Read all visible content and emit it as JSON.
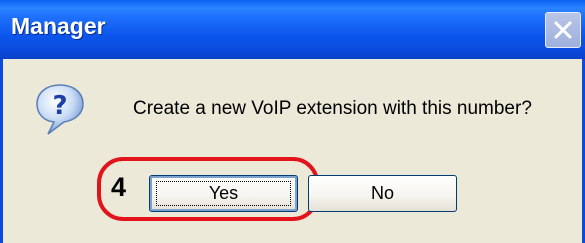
{
  "window": {
    "title": "Manager",
    "colors": {
      "titlebar": "#0a55ea",
      "dialog_bg": "#ece9d8",
      "annotation": "#e3131b"
    }
  },
  "dialog": {
    "icon": "question-icon",
    "message": "Create a new VoIP extension with this number?"
  },
  "buttons": {
    "yes_label": "Yes",
    "no_label": "No"
  },
  "annotation": {
    "step": "4"
  }
}
